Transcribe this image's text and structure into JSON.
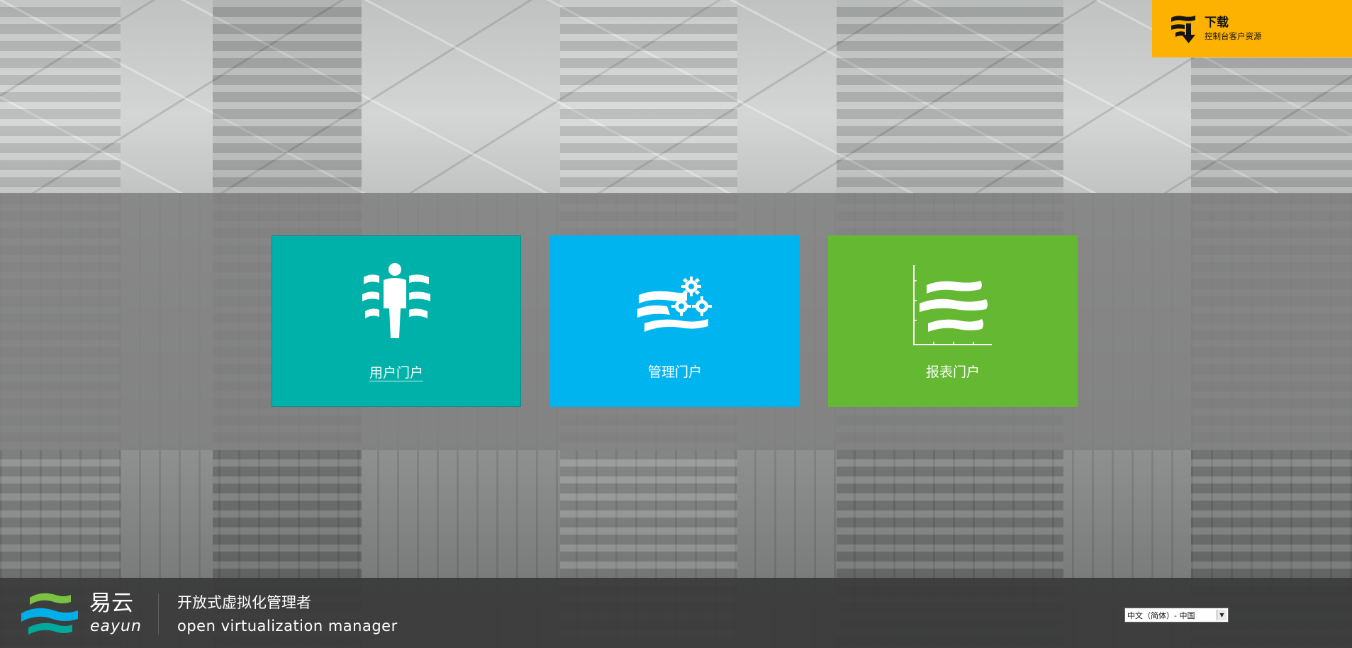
{
  "download": {
    "title": "下载",
    "subtitle": "控制台客户资源",
    "icon": "download-icon"
  },
  "portals": [
    {
      "label": "用户门户",
      "icon": "user-portal-icon",
      "color": "#00b1aa"
    },
    {
      "label": "管理门户",
      "icon": "admin-portal-icon",
      "color": "#00b4ef"
    },
    {
      "label": "报表门户",
      "icon": "report-portal-icon",
      "color": "#65b832"
    }
  ],
  "footer": {
    "logo_cn": "易云",
    "logo_en": "eayun",
    "tagline_cn": "开放式虚拟化管理者",
    "tagline_en": "open virtualization manager",
    "locale_selected": "中文（简体）- 中国"
  },
  "colors": {
    "download_bg": "#fdb100",
    "band_bg": "#808080",
    "footer_bg": "#3a3a3a"
  }
}
